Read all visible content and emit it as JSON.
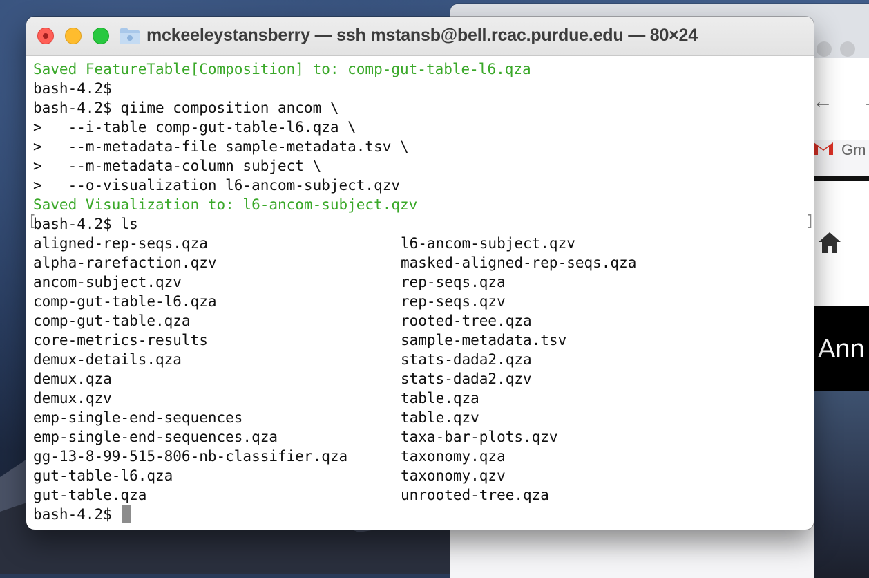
{
  "terminal": {
    "title": "mckeeleystansberry — ssh mstansb@bell.rcac.purdue.edu — 80×24",
    "lines": [
      {
        "text": "Saved FeatureTable[Composition] to: comp-gut-table-l6.qza",
        "color": "#3aa829"
      },
      {
        "text": "bash-4.2$",
        "color": "#111111"
      },
      {
        "text": "bash-4.2$ qiime composition ancom \\",
        "color": "#111111"
      },
      {
        "text": ">   --i-table comp-gut-table-l6.qza \\",
        "color": "#111111"
      },
      {
        "text": ">   --m-metadata-file sample-metadata.tsv \\",
        "color": "#111111"
      },
      {
        "text": ">   --m-metadata-column subject \\",
        "color": "#111111"
      },
      {
        "text": ">   --o-visualization l6-ancom-subject.qzv",
        "color": "#111111"
      },
      {
        "text": "Saved Visualization to: l6-ancom-subject.qzv",
        "color": "#3aa829"
      },
      {
        "text": "bash-4.2$ ls",
        "color": "#111111"
      }
    ],
    "ls_left": [
      "aligned-rep-seqs.qza",
      "alpha-rarefaction.qzv",
      "ancom-subject.qzv",
      "comp-gut-table-l6.qza",
      "comp-gut-table.qza",
      "core-metrics-results",
      "demux-details.qza",
      "demux.qza",
      "demux.qzv",
      "emp-single-end-sequences",
      "emp-single-end-sequences.qza",
      "gg-13-8-99-515-806-nb-classifier.qza",
      "gut-table-l6.qza",
      "gut-table.qza"
    ],
    "ls_right": [
      "l6-ancom-subject.qzv",
      "masked-aligned-rep-seqs.qza",
      "rep-seqs.qza",
      "rep-seqs.qzv",
      "rooted-tree.qza",
      "sample-metadata.tsv",
      "stats-dada2.qza",
      "stats-dada2.qzv",
      "table.qza",
      "table.qzv",
      "taxa-bar-plots.qzv",
      "taxonomy.qza",
      "taxonomy.qzv",
      "unrooted-tree.qza"
    ],
    "prompt": "bash-4.2$"
  },
  "browser": {
    "gmail_label": "Gm",
    "banner_text": "Ann"
  },
  "colors": {
    "green": "#3aa829",
    "close": "#ff5f57",
    "minimize": "#febc2e",
    "maximize": "#28c840"
  }
}
